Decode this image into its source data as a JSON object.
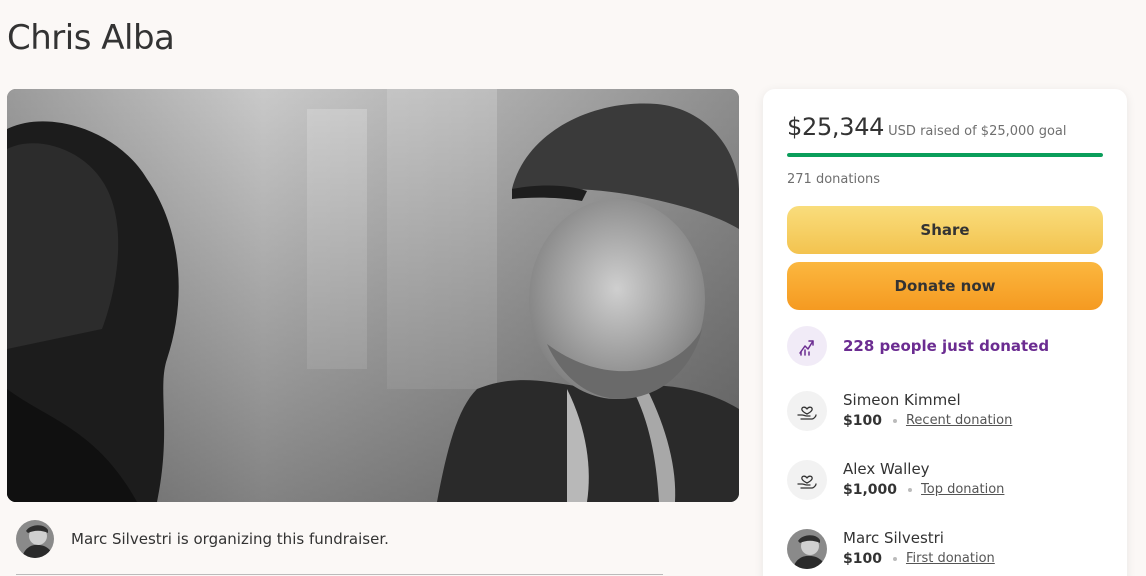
{
  "page": {
    "title": "Chris Alba"
  },
  "organizer": {
    "text": "Marc Silvestri is organizing this fundraiser."
  },
  "donation_card": {
    "raised_amount": "$25,344",
    "raised_suffix": "USD raised of $25,000 goal",
    "progress_percent": 100,
    "donation_count": "271 donations",
    "share_label": "Share",
    "donate_label": "Donate now",
    "trend_label": "228 people just donated",
    "donors": [
      {
        "name": "Simeon Kimmel",
        "amount": "$100",
        "tag": "Recent donation",
        "icon": "heart-hand-icon"
      },
      {
        "name": "Alex Walley",
        "amount": "$1,000",
        "tag": "Top donation",
        "icon": "heart-hand-icon"
      },
      {
        "name": "Marc Silvestri",
        "amount": "$100",
        "tag": "First donation",
        "icon": "avatar"
      }
    ]
  },
  "colors": {
    "progress": "#0a9e5b",
    "share_button": "#f3c34f",
    "donate_button": "#f59a21",
    "trend_text": "#6b2c91"
  }
}
